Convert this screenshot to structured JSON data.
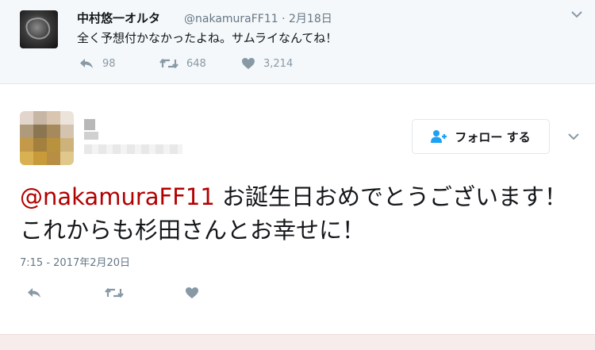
{
  "parent_tweet": {
    "display_name": "中村悠一オルタ",
    "handle_date": "@nakamuraFF11 · 2月18日",
    "text": "全く予想付かなかったよね。サムライなんてね！",
    "reply_count": "98",
    "retweet_count": "648",
    "like_count": "3,214"
  },
  "main_tweet": {
    "follow_label": "フォロー する",
    "mention": "@nakamuraFF11",
    "text_rest": " お誕生日おめでとうございます！これからも杉田さんとお幸せに！",
    "timestamp": "7:15 - 2017年2月20日"
  },
  "colors": {
    "mention": "#b30000",
    "icon_gray": "#8899a6",
    "follow_icon": "#1da1f2"
  },
  "icons": [
    "reply-icon",
    "retweet-icon",
    "heart-icon",
    "chevron-down-icon",
    "follow-person-plus-icon"
  ]
}
